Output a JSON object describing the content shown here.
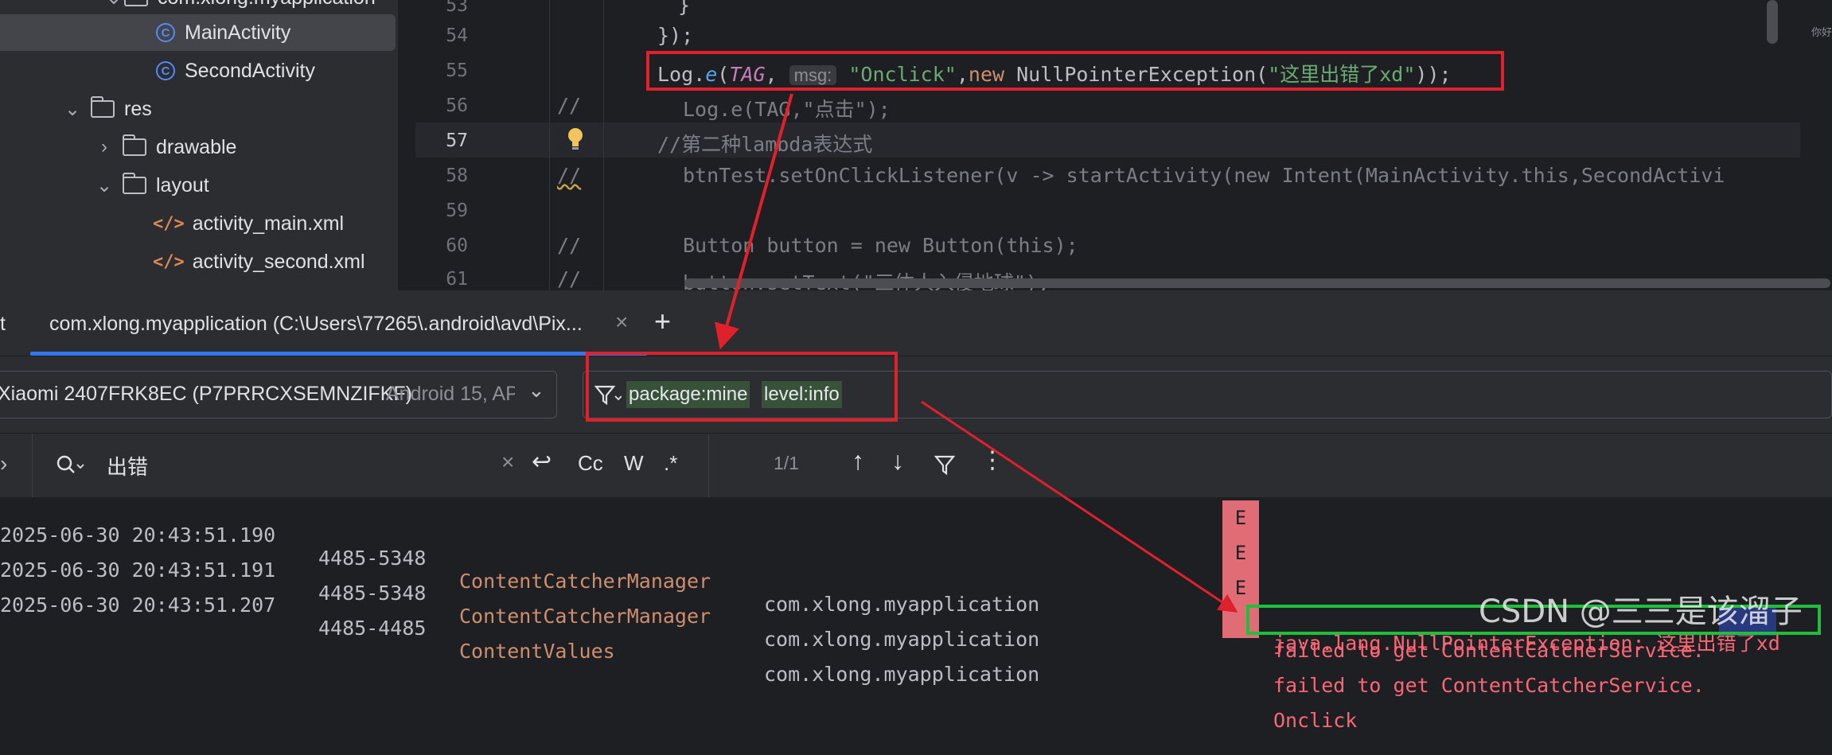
{
  "tree": {
    "items": [
      {
        "label": "com.xlong.myapplication"
      },
      {
        "label": "MainActivity"
      },
      {
        "label": "SecondActivity"
      },
      {
        "label": "res"
      },
      {
        "label": "drawable"
      },
      {
        "label": "layout"
      },
      {
        "label": "activity_main.xml"
      },
      {
        "label": "activity_second.xml"
      }
    ]
  },
  "editor": {
    "line_numbers": [
      "53",
      "54",
      "55",
      "56",
      "57",
      "58",
      "59",
      "60",
      "61"
    ],
    "lines": {
      "l53": "}",
      "l54": "});",
      "l55": {
        "log": "Log.",
        "method": "e",
        "paren": "(",
        "tag": "TAG",
        "comma": ",",
        "hint": "msg:",
        "str": "\"Onclick\"",
        "comma2": ",",
        "kw_new": "new",
        "cls": " NullPointerException(",
        "str2": "\"这里出错了xd\"",
        "end": "));"
      },
      "l56": "Log.e(TAG,\"点击\");",
      "l57": "//第二种lambda表达式",
      "l58": {
        "a": "btnTest.setOnClickListener(v -> startActivity(",
        "kw": "new",
        "b": " Intent(MainActivity.",
        "kw2": "this",
        "c": ",SecondActivi"
      },
      "l60": {
        "a": "Button button = ",
        "kw": "new",
        "b": " Button(this);"
      },
      "l61": "button.setText(\"三体人入侵地球\");",
      "comment_mark": "//",
      "right_gutter": "你好"
    }
  },
  "logcat": {
    "tab_prev": "t",
    "tab_label": "com.xlong.myapplication (C:\\Users\\77265\\.android\\avd\\Pix...",
    "device": "Xiaomi 2407FRK8EC (P7PRRCXSEMNZIFKF)",
    "device_os": "Android 15, AP",
    "filter_chips": [
      "package:mine",
      "level:info"
    ],
    "search_value": "出错",
    "search_options": {
      "case": "Cc",
      "word": "W",
      "regex": ".*"
    },
    "match_count": "1/1",
    "entries": [
      {
        "time": "2025-06-30 20:43:51.190",
        "pid": "4485-5348",
        "tag": "ContentCatcherManager",
        "pkg": "com.xlong.myapplication",
        "level": "E",
        "msg": "failed to get ContentCatcherService."
      },
      {
        "time": "2025-06-30 20:43:51.191",
        "pid": "4485-5348",
        "tag": "ContentCatcherManager",
        "pkg": "com.xlong.myapplication",
        "level": "E",
        "msg": "failed to get ContentCatcherService."
      },
      {
        "time": "2025-06-30 20:43:51.207",
        "pid": "4485-4485",
        "tag": "ContentValues",
        "pkg": "com.xlong.myapplication",
        "level": "E",
        "msg": "Onclick"
      }
    ],
    "exception_line": "java.lang.NullPointerException: 这里出错了xd"
  },
  "watermark": "CSDN @三三是该溜子",
  "colors": {
    "annotation_red": "#e0202a",
    "annotation_green": "#1fbf3b",
    "accent_blue": "#3574f0",
    "error": "#fa6675"
  }
}
